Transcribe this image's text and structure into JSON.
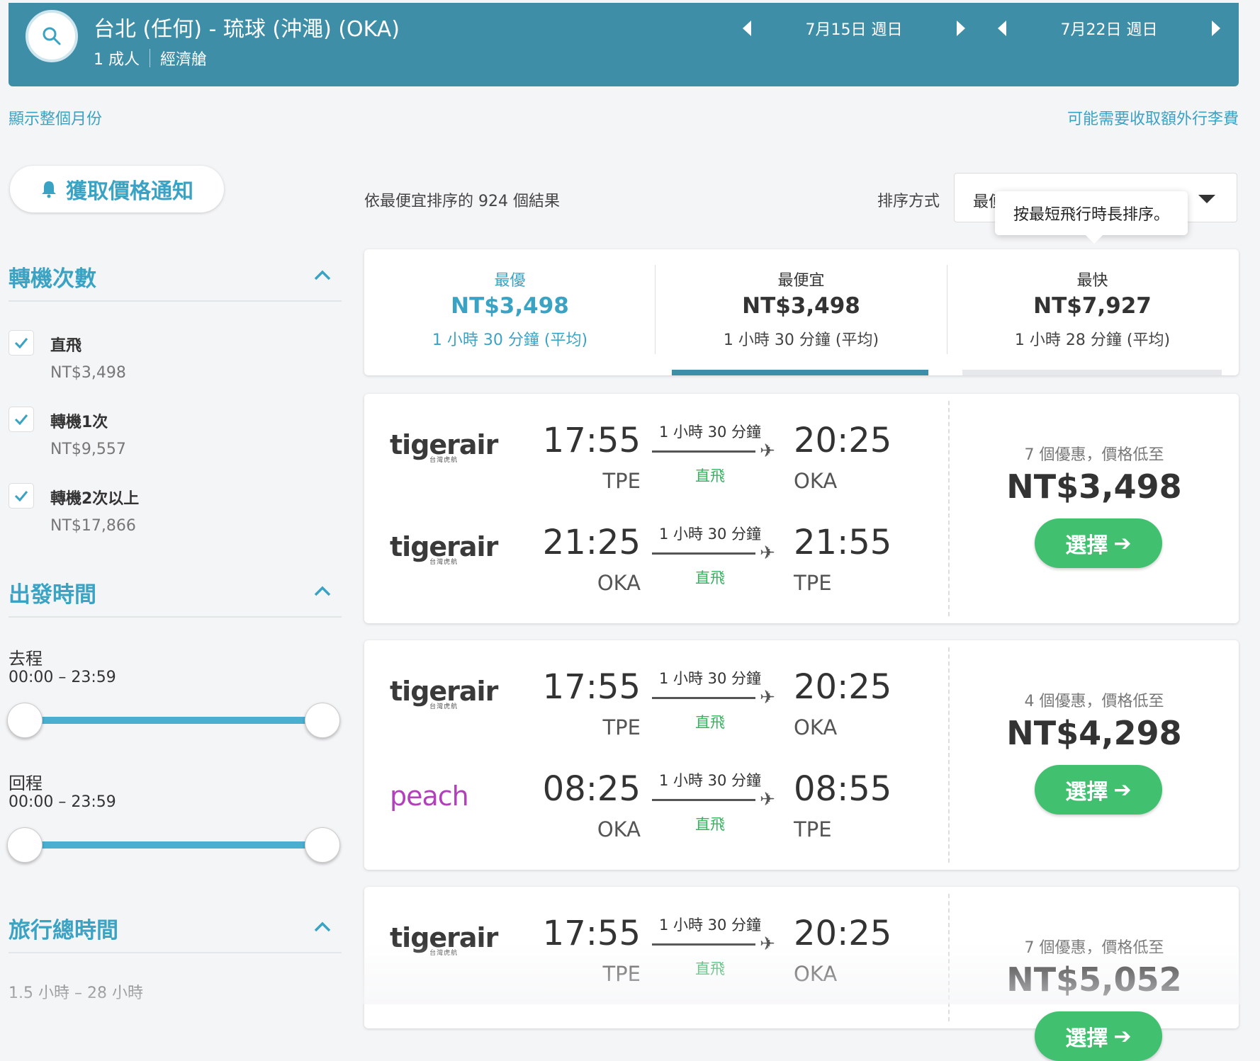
{
  "header": {
    "route": "台北 (任何) - 琉球 (沖澠) (OKA)",
    "passengers": "1 成人",
    "cabin": "經濟艙",
    "depart_date": "7月15日 週日",
    "return_date": "7月22日 週日"
  },
  "links": {
    "show_month": "顯示整個月份",
    "baggage_fees": "可能需要收取額外行李費"
  },
  "sidebar": {
    "price_alert": "獲取價格通知",
    "stops": {
      "title": "轉機次數",
      "options": [
        {
          "label": "直飛",
          "price": "NT$3,498"
        },
        {
          "label": "轉機1次",
          "price": "NT$9,557"
        },
        {
          "label": "轉機2次以上",
          "price": "NT$17,866"
        }
      ]
    },
    "times": {
      "title": "出發時間",
      "outbound_label": "去程",
      "outbound_range": "00:00 – 23:59",
      "return_label": "回程",
      "return_range": "00:00 – 23:59"
    },
    "duration": {
      "title": "旅行總時間",
      "range": "1.5 小時 – 28 小時"
    }
  },
  "results": {
    "count_text": "依最便宜排序的 924 個結果",
    "sort_label": "排序方式",
    "sort_value": "最便宜",
    "tooltip": "按最短飛行時長排序。",
    "tabs": [
      {
        "title": "最優",
        "price": "NT$3,498",
        "duration": "1 小時 30 分鐘 (平均)"
      },
      {
        "title": "最便宜",
        "price": "NT$3,498",
        "duration": "1 小時 30 分鐘 (平均)"
      },
      {
        "title": "最快",
        "price": "NT$7,927",
        "duration": "1 小時 28 分鐘 (平均)"
      }
    ],
    "cards": [
      {
        "legs": [
          {
            "airline": "tigerair",
            "airline_sub": "台灣虎航",
            "dep": "17:55",
            "dep_ap": "TPE",
            "dur": "1 小時 30 分鐘",
            "stops": "直飛",
            "arr": "20:25",
            "arr_ap": "OKA"
          },
          {
            "airline": "tigerair",
            "airline_sub": "台灣虎航",
            "dep": "21:25",
            "dep_ap": "OKA",
            "dur": "1 小時 30 分鐘",
            "stops": "直飛",
            "arr": "21:55",
            "arr_ap": "TPE"
          }
        ],
        "deals": "7 個優惠，價格低至",
        "price": "NT$3,498",
        "select": "選擇"
      },
      {
        "legs": [
          {
            "airline": "tigerair",
            "airline_sub": "台灣虎航",
            "dep": "17:55",
            "dep_ap": "TPE",
            "dur": "1 小時 30 分鐘",
            "stops": "直飛",
            "arr": "20:25",
            "arr_ap": "OKA"
          },
          {
            "airline": "peach",
            "dep": "08:25",
            "dep_ap": "OKA",
            "dur": "1 小時 30 分鐘",
            "stops": "直飛",
            "arr": "08:55",
            "arr_ap": "TPE"
          }
        ],
        "deals": "4 個優惠，價格低至",
        "price": "NT$4,298",
        "select": "選擇"
      },
      {
        "legs": [
          {
            "airline": "tigerair",
            "airline_sub": "台灣虎航",
            "dep": "17:55",
            "dep_ap": "TPE",
            "dur": "1 小時 30 分鐘",
            "stops": "直飛",
            "arr": "20:25",
            "arr_ap": "OKA"
          }
        ],
        "deals": "7 個優惠，價格低至",
        "price": "NT$5,052",
        "select": "選擇"
      }
    ]
  },
  "colors": {
    "header_bg": "#3e8ea7",
    "accent": "#3aa3c4",
    "select_green": "#41c06f",
    "direct_green": "#35b45e"
  },
  "icons": [
    "search-icon",
    "bell-icon",
    "chevron-up-icon",
    "check-icon",
    "triangle-left-icon",
    "triangle-right-icon",
    "caret-down-icon",
    "plane-icon",
    "arrow-right-icon"
  ]
}
